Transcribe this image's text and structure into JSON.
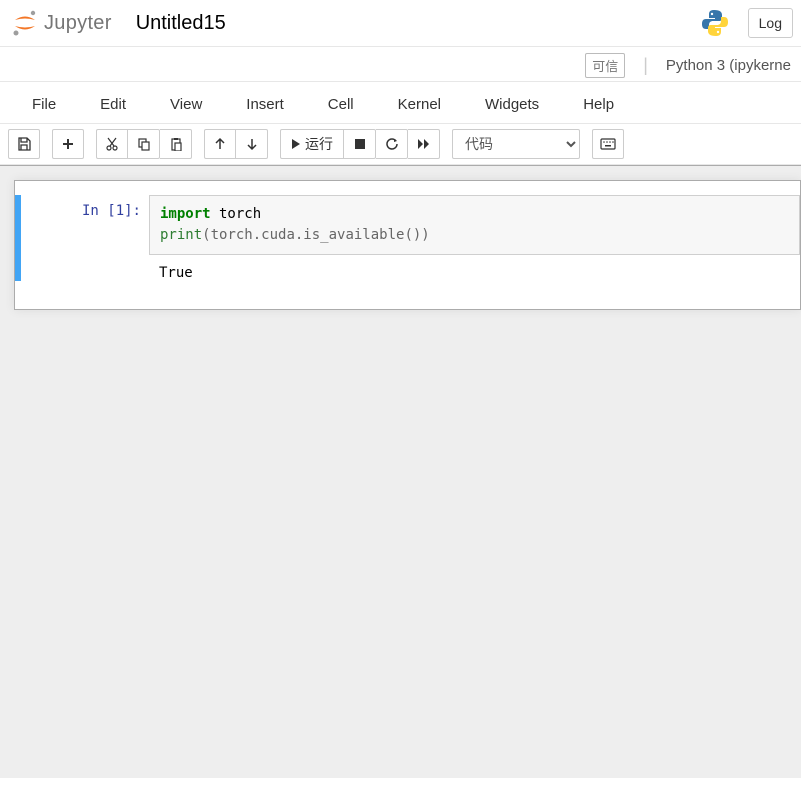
{
  "header": {
    "logo_text": "Jupyter",
    "title": "Untitled15",
    "login_label": "Log"
  },
  "status": {
    "trust": "可信",
    "kernel": "Python 3 (ipykerne"
  },
  "menu": {
    "file": "File",
    "edit": "Edit",
    "view": "View",
    "insert": "Insert",
    "cell": "Cell",
    "kernel": "Kernel",
    "widgets": "Widgets",
    "help": "Help"
  },
  "toolbar": {
    "run_label": "运行",
    "cell_type": "代码"
  },
  "cell1": {
    "prompt": "In  [1]:",
    "code": {
      "kw_import": "import",
      "mod": " torch",
      "fn_print": "print",
      "args": "(torch.cuda.is_available())"
    },
    "output": "True"
  }
}
